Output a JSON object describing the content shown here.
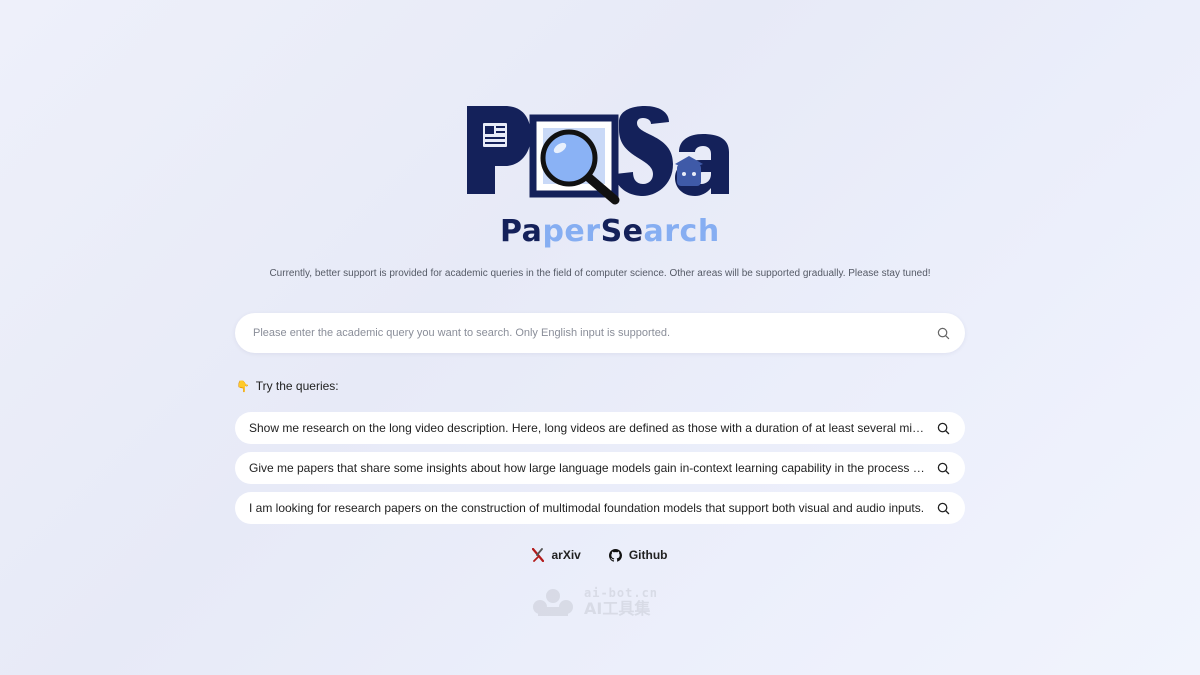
{
  "logo": {
    "name": "PaSa",
    "subtitle_parts": [
      "Pa",
      "per",
      "Se",
      "a",
      "rch"
    ]
  },
  "notice": "Currently, better support is provided for academic queries in the field of computer science. Other areas will be supported gradually. Please stay tuned!",
  "search": {
    "placeholder": "Please enter the academic query you want to search. Only English input is supported.",
    "value": "",
    "icon": "search-icon"
  },
  "try_label": "Try the queries:",
  "try_icon": "pointing-down-hand-icon",
  "queries": [
    "Show me research on the long video description. Here, long videos are defined as those with a duration of at least several minutes.",
    "Give me papers that share some insights about how large language models gain in-context learning capability in the process of pre-training.",
    "I am looking for research papers on the construction of multimodal foundation models that support both visual and audio inputs."
  ],
  "links": [
    {
      "label": "arXiv",
      "icon": "arxiv-icon"
    },
    {
      "label": "Github",
      "icon": "github-icon"
    }
  ],
  "watermark": {
    "top": "ai-bot.cn",
    "bottom": "AI工具集"
  },
  "colors": {
    "navy": "#14215a",
    "light_blue": "#86aef2",
    "arxiv_red": "#b31b1b"
  }
}
